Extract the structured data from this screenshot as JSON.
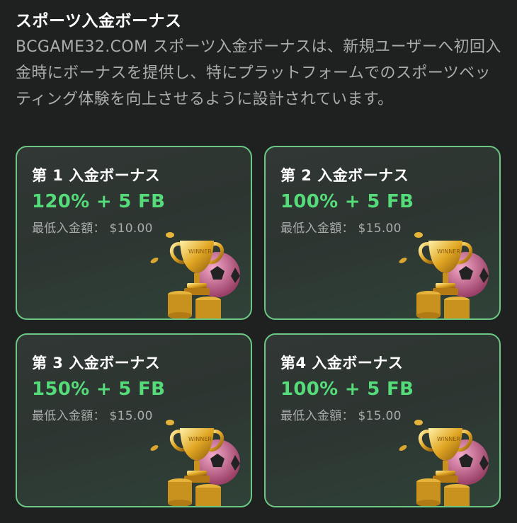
{
  "header": {
    "title": "スポーツ入金ボーナス",
    "description": "BCGAME32.COM スポーツ入金ボーナスは、新規ユーザーへ初回入金時にボーナスを提供し、特にプラットフォームでのスポーツベッティング体験を向上させるように設計されています。"
  },
  "cards": [
    {
      "title": "第 1 入金ボーナス",
      "bonus": "120% + 5 FB",
      "min_deposit": "最低入金額： $10.00"
    },
    {
      "title": "第 2 入金ボーナス",
      "bonus": "100% + 5 FB",
      "min_deposit": "最低入金額： $15.00"
    },
    {
      "title": "第 3  入金ボーナス",
      "bonus": "150% + 5 FB",
      "min_deposit": "最低入金額： $15.00"
    },
    {
      "title": "第4 入金ボーナス",
      "bonus": "100% + 5 FB",
      "min_deposit": "最低入金額： $15.00"
    }
  ],
  "colors": {
    "background": "#1f2120",
    "card_border": "#6cc784",
    "bonus_text": "#56db7b",
    "muted_text": "#a9acab"
  },
  "icons": [
    "trophy-icon",
    "soccer-ball-icon",
    "coin-stack-icon"
  ]
}
